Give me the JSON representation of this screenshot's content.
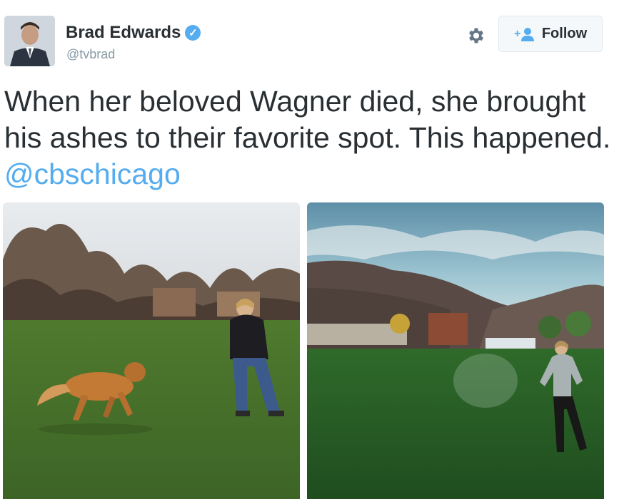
{
  "author": {
    "name": "Brad Edwards",
    "handle": "@tvbrad",
    "verified": true
  },
  "actions": {
    "settings_icon": "gear-icon",
    "follow_label": "Follow",
    "follow_icon": "add-user-icon"
  },
  "tweet": {
    "text": "When her beloved Wagner died, she brought his ashes to their favorite spot. This happened.",
    "mention": "@cbschicago"
  },
  "media": [
    {
      "name": "photo-woman-and-dog"
    },
    {
      "name": "photo-woman-with-ashes-in-valley"
    }
  ],
  "colors": {
    "link": "#55acee",
    "text": "#292f33",
    "muted": "#8899a6",
    "verified": "#55acee"
  }
}
